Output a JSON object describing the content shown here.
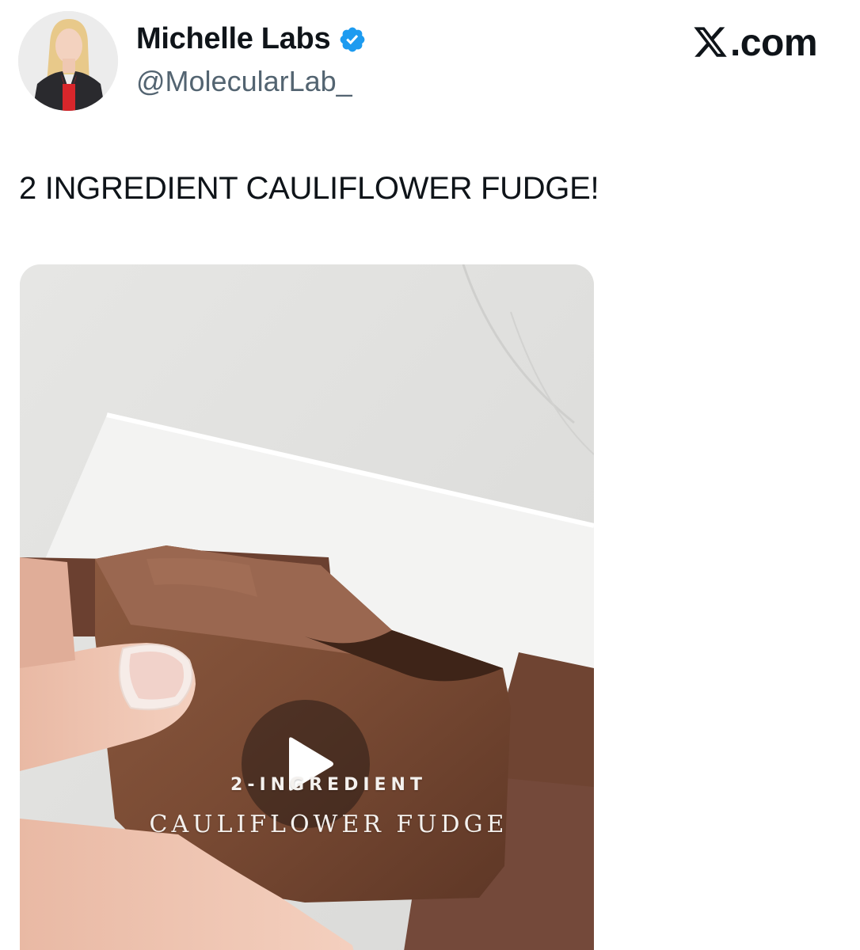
{
  "author": {
    "display_name": "Michelle Labs",
    "handle": "@MolecularLab_",
    "verified_icon": "verified-badge-icon",
    "avatar_icon": "avatar"
  },
  "brand": {
    "text": ".com",
    "logo_icon": "x-logo-icon"
  },
  "tweet": {
    "text": "2 INGREDIENT CAULIFLOWER FUDGE!"
  },
  "media": {
    "type": "video",
    "overlay_line1": "2-INGREDIENT",
    "overlay_line2": "CAULIFLOWER FUDGE",
    "play_icon": "play-icon"
  },
  "colors": {
    "verified": "#1d9bf0",
    "handle": "#536471",
    "text": "#0f1419"
  }
}
